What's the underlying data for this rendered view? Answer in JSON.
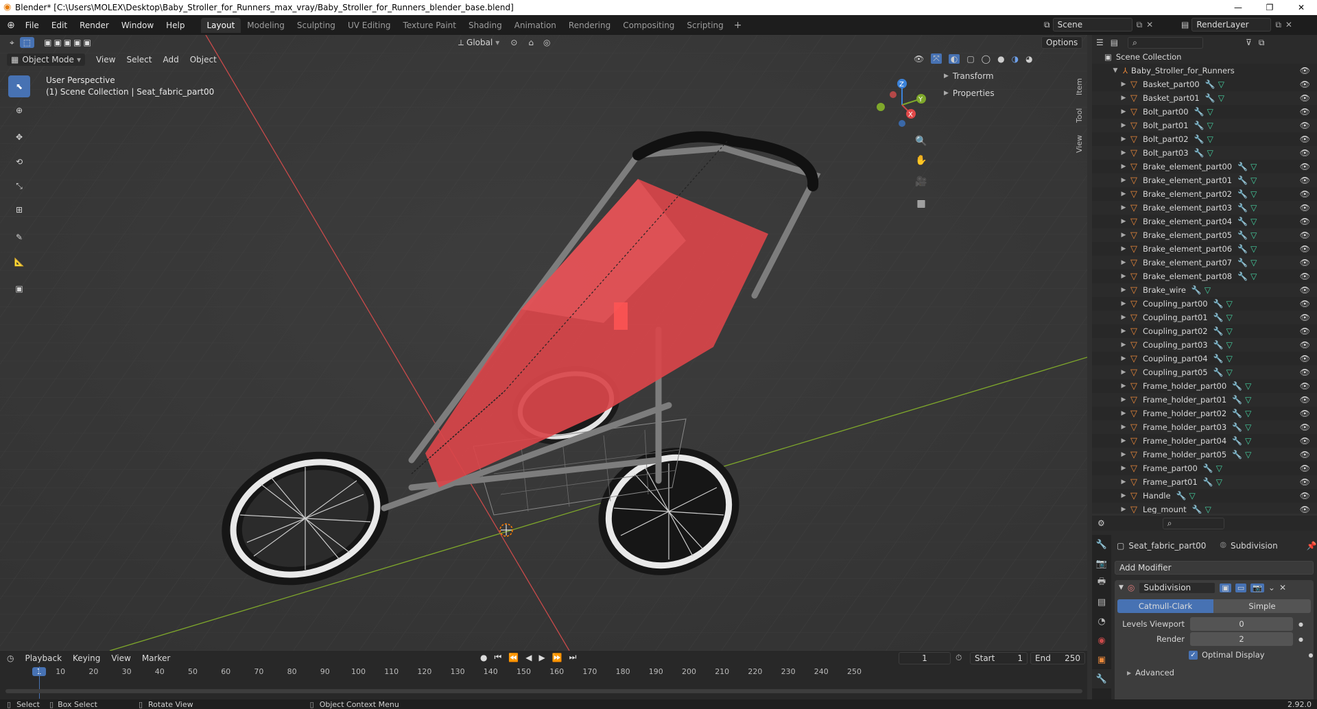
{
  "window": {
    "title": "Blender* [C:\\Users\\MOLEX\\Desktop\\Baby_Stroller_for_Runners_max_vray/Baby_Stroller_for_Runners_blender_base.blend]",
    "minimize": "—",
    "maximize": "❐",
    "close": "✕"
  },
  "menus": [
    "File",
    "Edit",
    "Render",
    "Window",
    "Help"
  ],
  "workspaces": [
    "Layout",
    "Modeling",
    "Sculpting",
    "UV Editing",
    "Texture Paint",
    "Shading",
    "Animation",
    "Rendering",
    "Compositing",
    "Scripting"
  ],
  "active_workspace": "Layout",
  "scene": {
    "name": "Scene",
    "render_layer": "RenderLayer"
  },
  "viewport": {
    "mode": "Object Mode",
    "header_menus": [
      "View",
      "Select",
      "Add",
      "Object"
    ],
    "orientation": "Global",
    "options_label": "Options",
    "overlay_title": "User Perspective",
    "overlay_sub": "(1) Scene Collection | Seat_fabric_part00",
    "panels": [
      "Transform",
      "Properties"
    ],
    "side_tabs": [
      "Item",
      "Tool",
      "View"
    ],
    "gizmo": {
      "x": "X",
      "y": "Y",
      "z": "Z"
    },
    "colors": {
      "bg": "#3a3a3a",
      "x_axis": "#c94a4a",
      "y_axis": "#7fa82b",
      "fabric": "#d9454a"
    }
  },
  "outliner": {
    "root": "Scene Collection",
    "collection": "Baby_Stroller_for_Runners",
    "items": [
      "Basket_part00",
      "Basket_part01",
      "Bolt_part00",
      "Bolt_part01",
      "Bolt_part02",
      "Bolt_part03",
      "Brake_element_part00",
      "Brake_element_part01",
      "Brake_element_part02",
      "Brake_element_part03",
      "Brake_element_part04",
      "Brake_element_part05",
      "Brake_element_part06",
      "Brake_element_part07",
      "Brake_element_part08",
      "Brake_wire",
      "Coupling_part00",
      "Coupling_part01",
      "Coupling_part02",
      "Coupling_part03",
      "Coupling_part04",
      "Coupling_part05",
      "Frame_holder_part00",
      "Frame_holder_part01",
      "Frame_holder_part02",
      "Frame_holder_part03",
      "Frame_holder_part04",
      "Frame_holder_part05",
      "Frame_part00",
      "Frame_part01",
      "Handle",
      "Leg_mount"
    ]
  },
  "properties": {
    "object": "Seat_fabric_part00",
    "modifier_context": "Subdivision",
    "add_modifier": "Add Modifier",
    "modifier_name": "Subdivision",
    "mode_a": "Catmull-Clark",
    "mode_b": "Simple",
    "levels_viewport_label": "Levels Viewport",
    "levels_viewport": "0",
    "render_label": "Render",
    "render_value": "2",
    "optimal_display": "Optimal Display",
    "advanced": "Advanced"
  },
  "timeline": {
    "menus": [
      "Playback",
      "Keying",
      "View",
      "Marker"
    ],
    "current_frame": "1",
    "start_label": "Start",
    "start": "1",
    "end_label": "End",
    "end": "250",
    "ticks": [
      "1",
      "10",
      "20",
      "30",
      "40",
      "50",
      "60",
      "70",
      "80",
      "90",
      "100",
      "110",
      "120",
      "130",
      "140",
      "150",
      "160",
      "170",
      "180",
      "190",
      "200",
      "210",
      "220",
      "230",
      "240",
      "250"
    ]
  },
  "status": {
    "select": "Select",
    "box_select": "Box Select",
    "rotate_view": "Rotate View",
    "context_menu": "Object Context Menu",
    "version": "2.92.0"
  }
}
